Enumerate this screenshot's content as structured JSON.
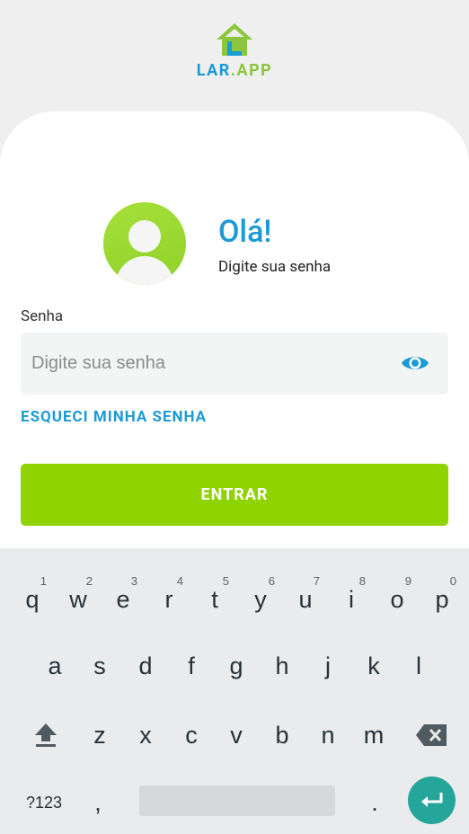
{
  "logo": {
    "part1": "LAR",
    "part2": ".",
    "part3": "APP"
  },
  "greeting": {
    "title": "Olá!",
    "subtitle": "Digite sua senha"
  },
  "password": {
    "label": "Senha",
    "placeholder": "Digite sua senha",
    "value": ""
  },
  "forgot_label": "ESQUECI MINHA SENHA",
  "enter_label": "ENTRAR",
  "keyboard": {
    "row1": [
      "q",
      "w",
      "e",
      "r",
      "t",
      "y",
      "u",
      "i",
      "o",
      "p"
    ],
    "row1_hints": [
      "1",
      "2",
      "3",
      "4",
      "5",
      "6",
      "7",
      "8",
      "9",
      "0"
    ],
    "row2": [
      "a",
      "s",
      "d",
      "f",
      "g",
      "h",
      "j",
      "k",
      "l"
    ],
    "row3": [
      "z",
      "x",
      "c",
      "v",
      "b",
      "n",
      "m"
    ],
    "symbols_label": "?123",
    "comma": ",",
    "period": "."
  },
  "colors": {
    "brand_blue": "#1b9ad6",
    "brand_green": "#8fd400",
    "enter_teal": "#26a69a"
  }
}
